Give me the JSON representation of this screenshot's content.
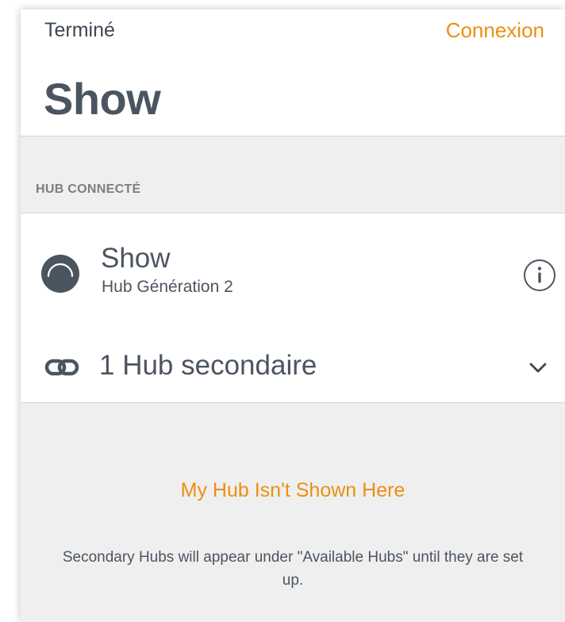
{
  "nav": {
    "done_label": "Terminé",
    "connect_label": "Connexion"
  },
  "page": {
    "title": "Show"
  },
  "connected_section": {
    "label": "HUB CONNECTÉ",
    "hub": {
      "name": "Show",
      "subtitle": "Hub Génération 2",
      "avatar_icon": "hub-status-icon",
      "info_icon": "info-icon"
    },
    "secondary": {
      "label": "1 Hub secondaire",
      "link_icon": "link-icon",
      "expand_icon": "chevron-down-icon"
    }
  },
  "help": {
    "link_label": "My Hub Isn't Shown Here",
    "description": "Secondary Hubs will appear under \"Available Hubs\" until they are set up."
  },
  "colors": {
    "accent": "#ec8f12",
    "text_primary": "#4b5560",
    "background": "#efefef",
    "surface": "#ffffff"
  }
}
